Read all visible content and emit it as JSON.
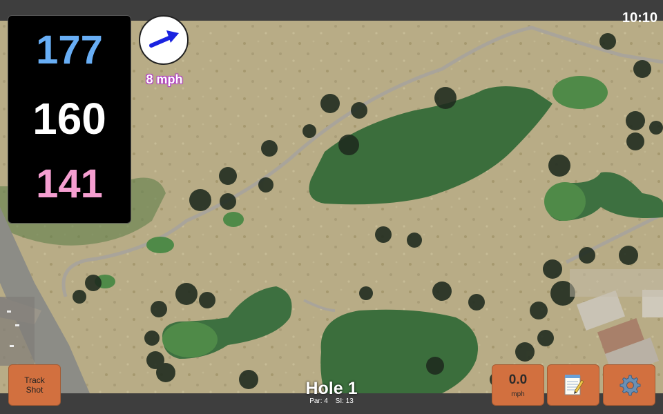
{
  "status": {
    "clock": "10:10"
  },
  "distances": {
    "back": "177",
    "middle": "160",
    "front": "141"
  },
  "wind": {
    "speed": "8 mph",
    "icon": "wind-direction-arrow-icon",
    "arrow_color": "#1a23e0"
  },
  "hole": {
    "title": "Hole 1",
    "par": "Par: 4",
    "stroke_index": "SI: 13"
  },
  "buttons": {
    "track_shot": "Track Shot",
    "speed_value": "0.0",
    "speed_unit": "mph",
    "notes_icon": "notepad-icon",
    "settings_icon": "gear-icon"
  },
  "colors": {
    "accent_button": "#d2703f",
    "distance_back": "#68aef5",
    "distance_middle": "#ffffff",
    "distance_front": "#f59ed0",
    "fairway": "#3b6e3c",
    "green": "#4f8a48"
  }
}
